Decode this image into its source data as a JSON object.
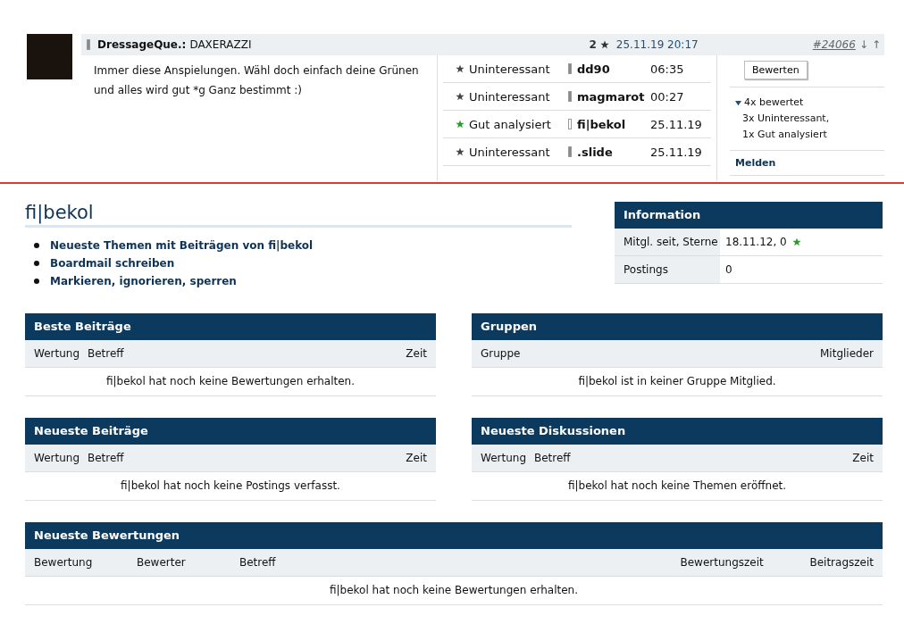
{
  "post": {
    "author_label": "DressageQue.:",
    "author": "DAXERAZZI",
    "author_bar": {
      "filled": true
    },
    "rating_count": "2",
    "timestamp": "25.11.19 20:17",
    "post_id": "#24066",
    "down_arrow": "↓",
    "up_arrow": "↑",
    "text": "Immer diese Anspielungen. Wähl doch einfach deine Grünen und alles wird gut *g  Ganz bestimmt :)",
    "ratings": [
      {
        "label": "Uninteressant",
        "color": "#444444",
        "user": "dd90",
        "rank_filled": true,
        "time": "06:35"
      },
      {
        "label": "Uninteressant",
        "color": "#444444",
        "user": "magmarot",
        "rank_filled": true,
        "time": "00:27"
      },
      {
        "label": "Gut analysiert",
        "color": "#2a9a2a",
        "user": "fi|bekol",
        "rank_filled": false,
        "time": "25.11.19"
      },
      {
        "label": "Uninteressant",
        "color": "#444444",
        "user": ".slide",
        "rank_filled": true,
        "time": "25.11.19"
      }
    ],
    "rate_button": "Bewerten",
    "summary": {
      "title": "4x bewertet",
      "expanded": true,
      "lines": [
        "3x Uninteressant,",
        "1x Gut analysiert"
      ]
    },
    "report_link": "Melden"
  },
  "profile": {
    "name": "fi|bekol",
    "links": [
      "Neueste Themen mit Beiträgen von fi|bekol",
      "Boardmail schreiben",
      "Markieren, ignorieren, sperren"
    ]
  },
  "information": {
    "title": "Information",
    "rows": [
      {
        "label": "Mitgl. seit, Sterne",
        "value": "18.11.12, 0",
        "star": true
      },
      {
        "label": "Postings",
        "value": "0",
        "star": false
      }
    ]
  },
  "sections": [
    {
      "title": "Beste Beiträge",
      "columns": [
        "Wertung",
        "Betreff",
        "Zeit"
      ],
      "empty": "fi|bekol hat noch keine Bewertungen erhalten."
    },
    {
      "title": "Gruppen",
      "columns": [
        "Gruppe",
        "Mitglieder"
      ],
      "empty": "fi|bekol ist in keiner Gruppe Mitglied."
    },
    {
      "title": "Neueste Beiträge",
      "columns": [
        "Wertung",
        "Betreff",
        "Zeit"
      ],
      "empty": "fi|bekol hat noch keine Postings verfasst."
    },
    {
      "title": "Neueste Diskussionen",
      "columns": [
        "Wertung",
        "Betreff",
        "Zeit"
      ],
      "empty": "fi|bekol hat noch keine Themen eröffnet."
    }
  ],
  "ratings_section": {
    "title": "Neueste Bewertungen",
    "columns": [
      "Bewertung",
      "Bewerter",
      "Betreff",
      "Bewertungszeit",
      "Beitragszeit"
    ],
    "empty": "fi|bekol hat noch keine Bewertungen erhalten."
  }
}
